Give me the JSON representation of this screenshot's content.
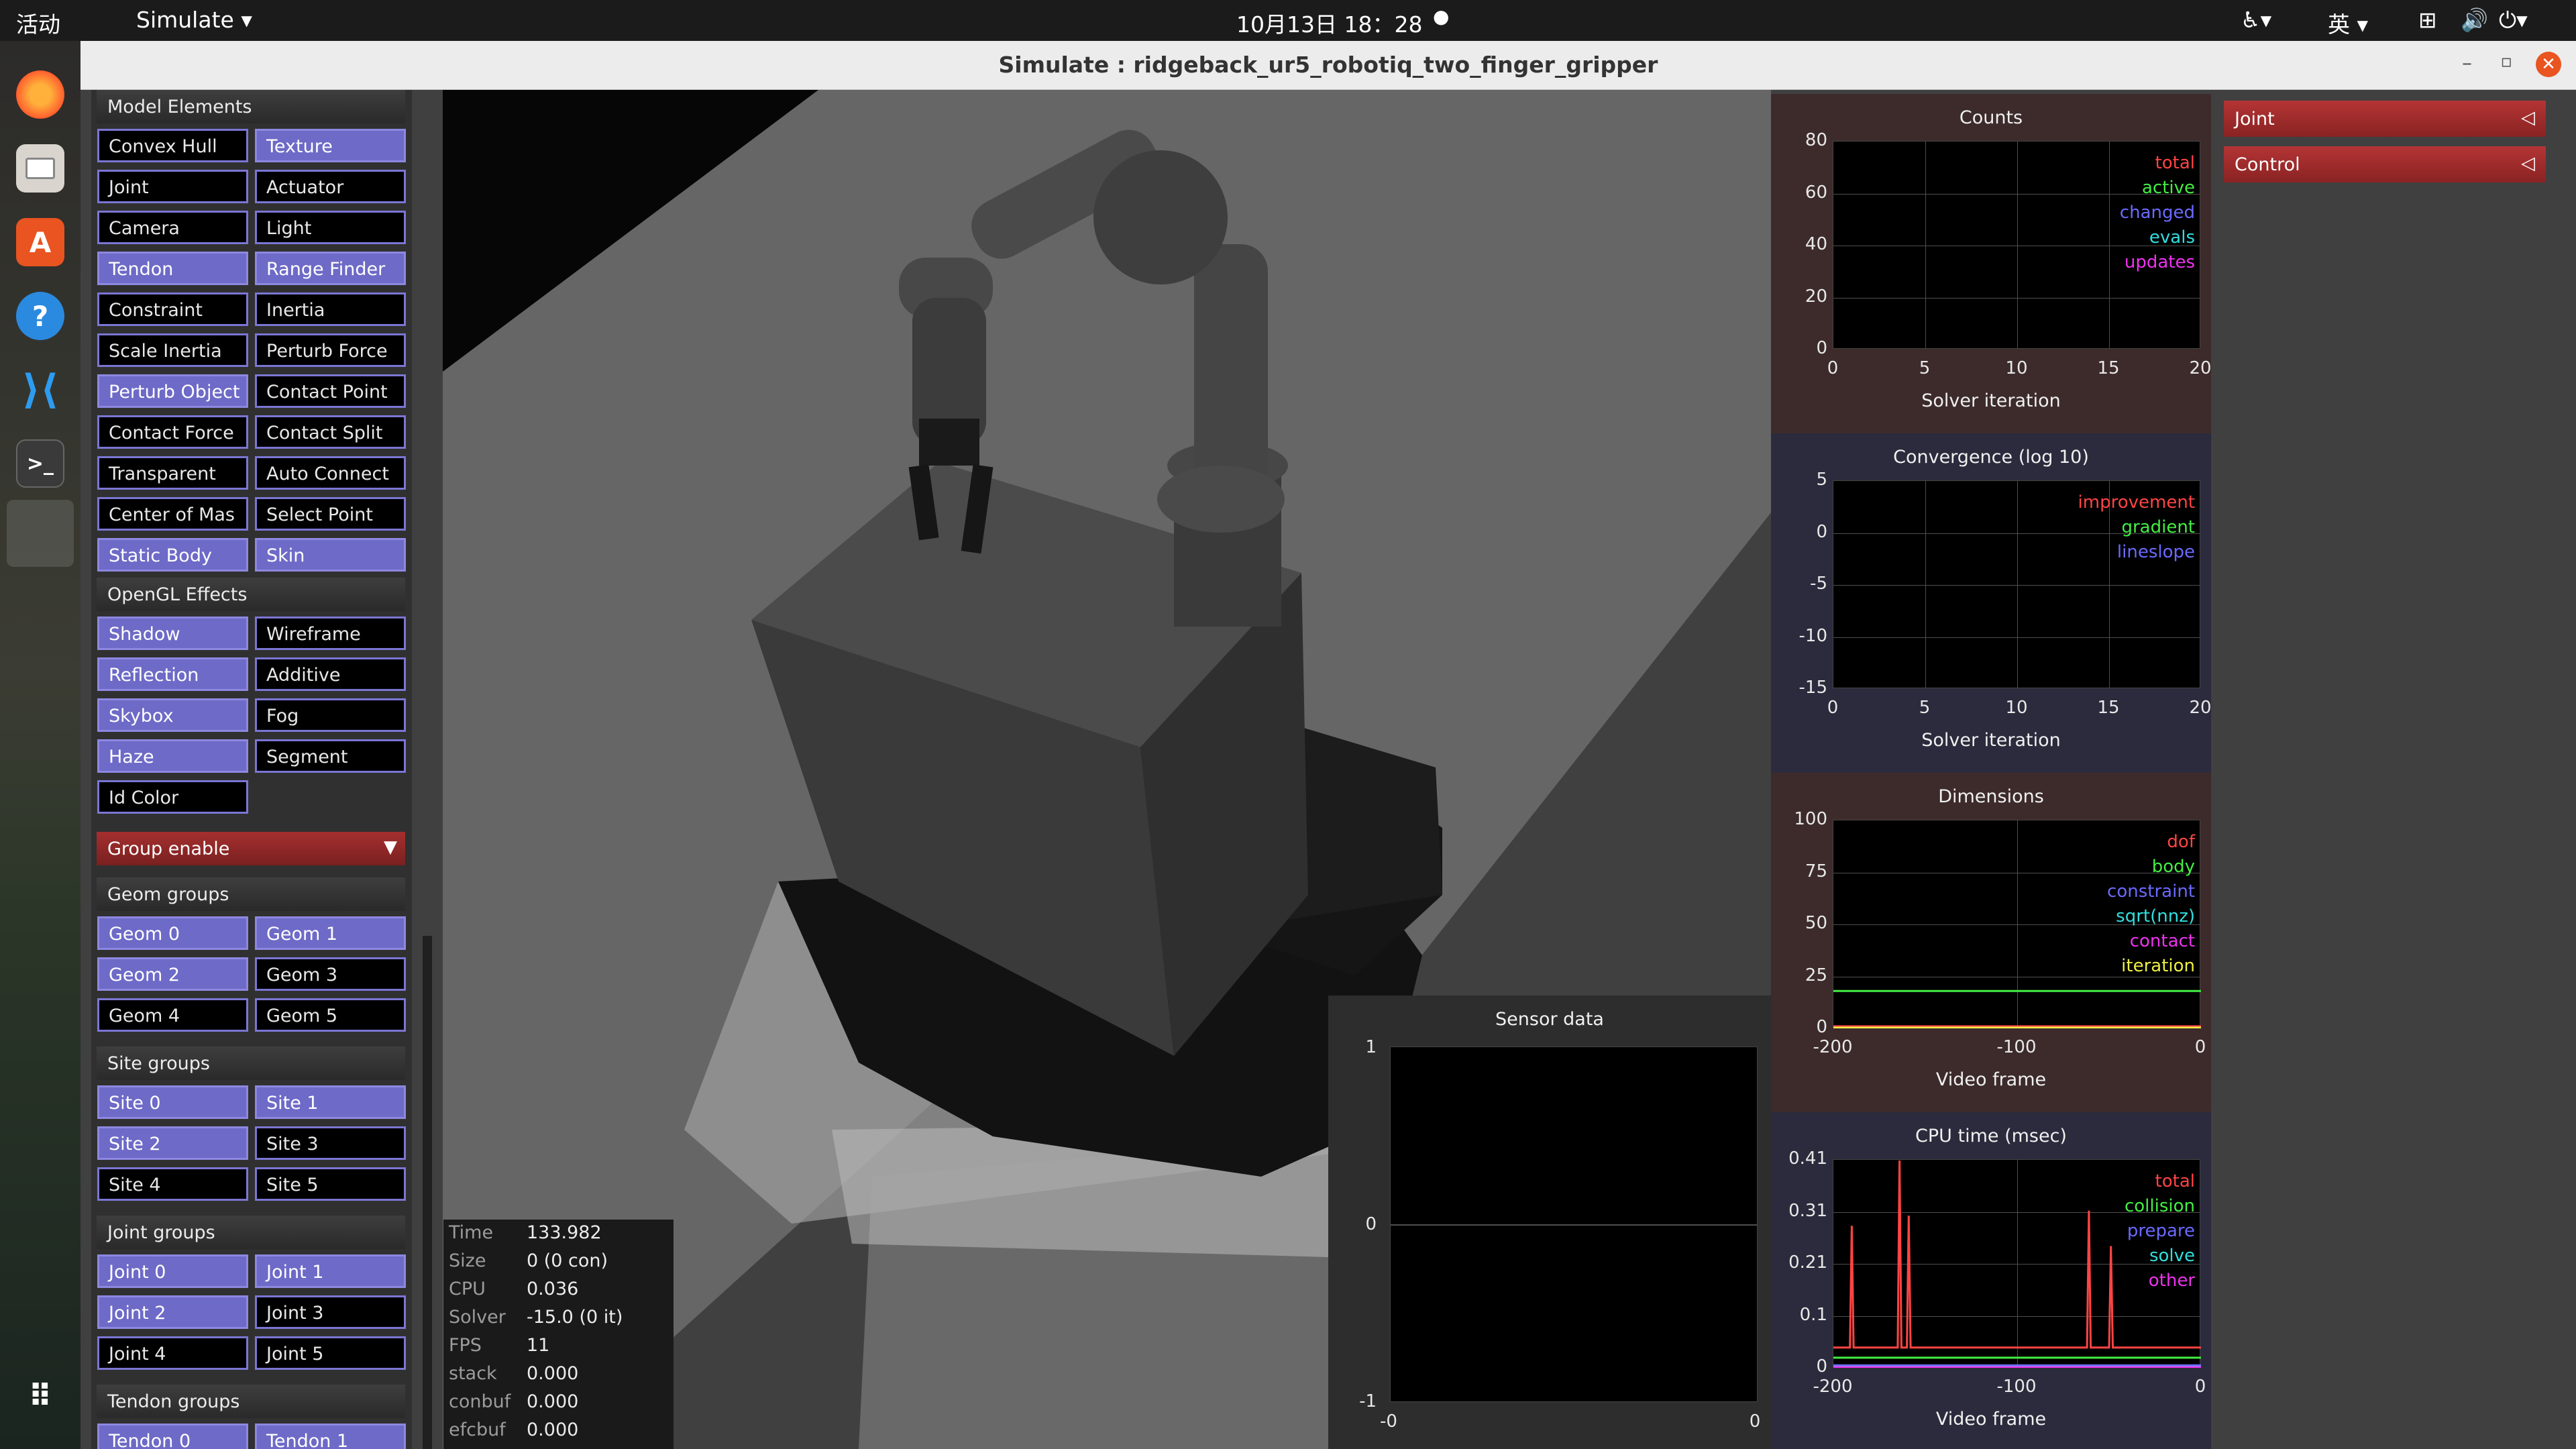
{
  "topbar": {
    "activities": "活动",
    "app_menu": "Simulate",
    "datetime": "10月13日 18：28",
    "input_method": "英"
  },
  "window": {
    "title": "Simulate : ridgeback_ur5_robotiq_two_finger_gripper"
  },
  "dock": {
    "icons": [
      "firefox-icon",
      "files-icon",
      "software-icon",
      "help-icon",
      "vscode-icon",
      "terminal-icon",
      "blank-app-icon",
      "apps-grid-icon"
    ]
  },
  "left_panel": {
    "model_elements": {
      "title": "Model Elements",
      "buttons": [
        {
          "label": "Convex Hull",
          "on": false
        },
        {
          "label": "Texture",
          "on": true
        },
        {
          "label": "Joint",
          "on": false
        },
        {
          "label": "Actuator",
          "on": false
        },
        {
          "label": "Camera",
          "on": false
        },
        {
          "label": "Light",
          "on": false
        },
        {
          "label": "Tendon",
          "on": true
        },
        {
          "label": "Range Finder",
          "on": true
        },
        {
          "label": "Constraint",
          "on": false
        },
        {
          "label": "Inertia",
          "on": false
        },
        {
          "label": "Scale Inertia",
          "on": false
        },
        {
          "label": "Perturb Force",
          "on": false
        },
        {
          "label": "Perturb Object",
          "on": true
        },
        {
          "label": "Contact Point",
          "on": false
        },
        {
          "label": "Contact Force",
          "on": false
        },
        {
          "label": "Contact Split",
          "on": false
        },
        {
          "label": "Transparent",
          "on": false
        },
        {
          "label": "Auto Connect",
          "on": false
        },
        {
          "label": "Center of Mas",
          "on": false
        },
        {
          "label": "Select Point",
          "on": false
        },
        {
          "label": "Static Body",
          "on": true
        },
        {
          "label": "Skin",
          "on": true
        }
      ]
    },
    "opengl_effects": {
      "title": "OpenGL Effects",
      "buttons": [
        {
          "label": "Shadow",
          "on": true
        },
        {
          "label": "Wireframe",
          "on": false
        },
        {
          "label": "Reflection",
          "on": true
        },
        {
          "label": "Additive",
          "on": false
        },
        {
          "label": "Skybox",
          "on": true
        },
        {
          "label": "Fog",
          "on": false
        },
        {
          "label": "Haze",
          "on": true
        },
        {
          "label": "Segment",
          "on": false
        },
        {
          "label": "Id Color",
          "on": false
        }
      ]
    },
    "group_enable": {
      "title": "Group enable",
      "arrow": "▼"
    },
    "geom_groups": {
      "title": "Geom groups",
      "buttons": [
        {
          "label": "Geom 0",
          "on": true
        },
        {
          "label": "Geom 1",
          "on": true
        },
        {
          "label": "Geom 2",
          "on": true
        },
        {
          "label": "Geom 3",
          "on": false
        },
        {
          "label": "Geom 4",
          "on": false
        },
        {
          "label": "Geom 5",
          "on": false
        }
      ]
    },
    "site_groups": {
      "title": "Site groups",
      "buttons": [
        {
          "label": "Site 0",
          "on": true
        },
        {
          "label": "Site 1",
          "on": true
        },
        {
          "label": "Site 2",
          "on": true
        },
        {
          "label": "Site 3",
          "on": false
        },
        {
          "label": "Site 4",
          "on": false
        },
        {
          "label": "Site 5",
          "on": false
        }
      ]
    },
    "joint_groups": {
      "title": "Joint groups",
      "buttons": [
        {
          "label": "Joint 0",
          "on": true
        },
        {
          "label": "Joint 1",
          "on": true
        },
        {
          "label": "Joint 2",
          "on": true
        },
        {
          "label": "Joint 3",
          "on": false
        },
        {
          "label": "Joint 4",
          "on": false
        },
        {
          "label": "Joint 5",
          "on": false
        }
      ]
    },
    "tendon_groups": {
      "title": "Tendon groups",
      "buttons": [
        {
          "label": "Tendon 0",
          "on": true
        },
        {
          "label": "Tendon 1",
          "on": true
        }
      ]
    }
  },
  "right_panel": {
    "sections": [
      {
        "label": "Joint",
        "arrow": "◁"
      },
      {
        "label": "Control",
        "arrow": "◁"
      }
    ]
  },
  "info": {
    "rows": [
      {
        "key": "Time",
        "value": "133.982"
      },
      {
        "key": "Size",
        "value": "0  (0 con)"
      },
      {
        "key": "CPU",
        "value": "0.036"
      },
      {
        "key": "Solver",
        "value": "-15.0  (0 it)"
      },
      {
        "key": "FPS",
        "value": "11"
      },
      {
        "key": "stack",
        "value": "0.000"
      },
      {
        "key": "conbuf",
        "value": "0.000"
      },
      {
        "key": "efcbuf",
        "value": "0.000"
      }
    ]
  },
  "sensor": {
    "title": "Sensor data",
    "yticks": [
      "1",
      "0",
      "-1"
    ],
    "xticks": [
      "-0",
      "0"
    ]
  },
  "charts": [
    {
      "title": "Counts",
      "bg": "#3d2b2b",
      "yticks": [
        "80",
        "60",
        "40",
        "20",
        "0"
      ],
      "xticks": [
        "0",
        "5",
        "10",
        "15",
        "20"
      ],
      "xlabel": "Solver iteration",
      "legend": [
        {
          "name": "total",
          "color": "#ff4444"
        },
        {
          "name": "active",
          "color": "#44ee44"
        },
        {
          "name": "changed",
          "color": "#6a6aff"
        },
        {
          "name": "evals",
          "color": "#33dddd"
        },
        {
          "name": "updates",
          "color": "#ee33ee"
        }
      ]
    },
    {
      "title": "Convergence (log 10)",
      "bg": "#2b2b3d",
      "yticks": [
        "5",
        "0",
        "-5",
        "-10",
        "-15"
      ],
      "xticks": [
        "0",
        "5",
        "10",
        "15",
        "20"
      ],
      "xlabel": "Solver iteration",
      "legend": [
        {
          "name": "improvement",
          "color": "#ff4444"
        },
        {
          "name": "gradient",
          "color": "#44ee44"
        },
        {
          "name": "lineslope",
          "color": "#6a6aff"
        }
      ]
    },
    {
      "title": "Dimensions",
      "bg": "#3d2b2b",
      "yticks": [
        "100",
        "75",
        "50",
        "25",
        "0"
      ],
      "xticks": [
        "-200",
        "-100",
        "0"
      ],
      "xlabel": "Video frame",
      "legend": [
        {
          "name": "dof",
          "color": "#ff4444"
        },
        {
          "name": "body",
          "color": "#44ee44"
        },
        {
          "name": "constraint",
          "color": "#6a6aff"
        },
        {
          "name": "sqrt(nnz)",
          "color": "#33dddd"
        },
        {
          "name": "contact",
          "color": "#ee33ee"
        },
        {
          "name": "iteration",
          "color": "#eeee44"
        }
      ]
    },
    {
      "title": "CPU time (msec)",
      "bg": "#2b2b3d",
      "yticks": [
        "0.41",
        "0.31",
        "0.21",
        "0.1",
        "0"
      ],
      "xticks": [
        "-200",
        "-100",
        "0"
      ],
      "xlabel": "Video frame",
      "legend": [
        {
          "name": "total",
          "color": "#ff4444"
        },
        {
          "name": "collision",
          "color": "#44ee44"
        },
        {
          "name": "prepare",
          "color": "#6a6aff"
        },
        {
          "name": "solve",
          "color": "#33dddd"
        },
        {
          "name": "other",
          "color": "#ee33ee"
        }
      ]
    }
  ],
  "chart_data": [
    {
      "type": "line",
      "title": "Counts",
      "xlabel": "Solver iteration",
      "ylabel": "",
      "xlim": [
        0,
        20
      ],
      "ylim": [
        0,
        80
      ],
      "series": [
        {
          "name": "total",
          "x": [],
          "y": []
        },
        {
          "name": "active",
          "x": [],
          "y": []
        },
        {
          "name": "changed",
          "x": [],
          "y": []
        },
        {
          "name": "evals",
          "x": [],
          "y": []
        },
        {
          "name": "updates",
          "x": [],
          "y": []
        }
      ]
    },
    {
      "type": "line",
      "title": "Convergence (log 10)",
      "xlabel": "Solver iteration",
      "ylabel": "",
      "xlim": [
        0,
        20
      ],
      "ylim": [
        -15,
        5
      ],
      "series": [
        {
          "name": "improvement",
          "x": [],
          "y": []
        },
        {
          "name": "gradient",
          "x": [],
          "y": []
        },
        {
          "name": "lineslope",
          "x": [],
          "y": []
        }
      ]
    },
    {
      "type": "line",
      "title": "Dimensions",
      "xlabel": "Video frame",
      "ylabel": "",
      "xlim": [
        -200,
        0
      ],
      "ylim": [
        0,
        100
      ],
      "series": [
        {
          "name": "dof",
          "x": [
            -200,
            0
          ],
          "y": [
            1,
            1
          ]
        },
        {
          "name": "body",
          "x": [
            -200,
            0
          ],
          "y": [
            18,
            18
          ]
        },
        {
          "name": "constraint",
          "x": [
            -200,
            0
          ],
          "y": [
            0,
            0
          ]
        },
        {
          "name": "sqrt(nnz)",
          "x": [
            -200,
            0
          ],
          "y": [
            0,
            0
          ]
        },
        {
          "name": "contact",
          "x": [
            -200,
            0
          ],
          "y": [
            0,
            0
          ]
        },
        {
          "name": "iteration",
          "x": [
            -200,
            0
          ],
          "y": [
            0,
            0
          ]
        }
      ]
    },
    {
      "type": "line",
      "title": "CPU time (msec)",
      "xlabel": "Video frame",
      "ylabel": "",
      "xlim": [
        -200,
        0
      ],
      "ylim": [
        0,
        0.41
      ],
      "series": [
        {
          "name": "total",
          "x": [
            -200,
            -191,
            -190,
            -189,
            -170,
            -165,
            -164,
            -163,
            -160,
            -159,
            -158,
            -120,
            -80,
            -62,
            -61,
            -60,
            -50,
            -49,
            -48,
            -20,
            0
          ],
          "y": [
            0.04,
            0.04,
            0.28,
            0.04,
            0.04,
            0.04,
            0.41,
            0.04,
            0.04,
            0.3,
            0.04,
            0.04,
            0.04,
            0.04,
            0.31,
            0.04,
            0.04,
            0.24,
            0.04,
            0.04,
            0.04
          ]
        },
        {
          "name": "collision",
          "x": [
            -200,
            0
          ],
          "y": [
            0.02,
            0.02
          ]
        },
        {
          "name": "prepare",
          "x": [
            -200,
            0
          ],
          "y": [
            0.005,
            0.005
          ]
        },
        {
          "name": "solve",
          "x": [
            -200,
            0
          ],
          "y": [
            0.002,
            0.002
          ]
        },
        {
          "name": "other",
          "x": [
            -200,
            0
          ],
          "y": [
            0.001,
            0.001
          ]
        }
      ]
    }
  ]
}
